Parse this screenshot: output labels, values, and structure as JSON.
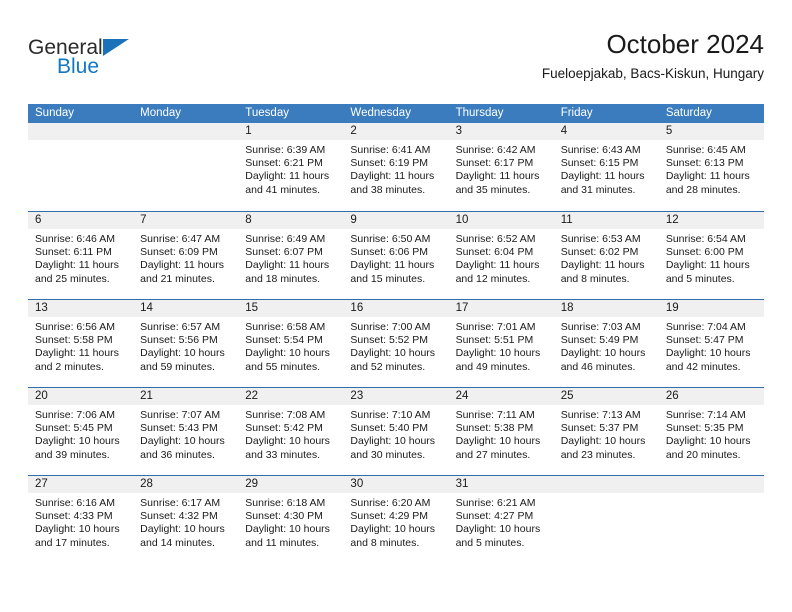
{
  "brand": {
    "name_part1": "General",
    "name_part2": "Blue",
    "accent_color": "#1b72b8"
  },
  "header": {
    "title": "October 2024",
    "subtitle": "Fueloepjakab, Bacs-Kiskun, Hungary"
  },
  "theme": {
    "header_blue": "#3a7cbe",
    "row_divider_blue": "#2f6ea8",
    "daynum_band": "#f0f0f0",
    "text": "#1a1a1a"
  },
  "weekdays": [
    "Sunday",
    "Monday",
    "Tuesday",
    "Wednesday",
    "Thursday",
    "Friday",
    "Saturday"
  ],
  "weeks": [
    [
      {
        "day": "",
        "sunrise": "",
        "sunset": "",
        "daylight_line1": "",
        "daylight_line2": ""
      },
      {
        "day": "",
        "sunrise": "",
        "sunset": "",
        "daylight_line1": "",
        "daylight_line2": ""
      },
      {
        "day": "1",
        "sunrise": "Sunrise: 6:39 AM",
        "sunset": "Sunset: 6:21 PM",
        "daylight_line1": "Daylight: 11 hours",
        "daylight_line2": "and 41 minutes."
      },
      {
        "day": "2",
        "sunrise": "Sunrise: 6:41 AM",
        "sunset": "Sunset: 6:19 PM",
        "daylight_line1": "Daylight: 11 hours",
        "daylight_line2": "and 38 minutes."
      },
      {
        "day": "3",
        "sunrise": "Sunrise: 6:42 AM",
        "sunset": "Sunset: 6:17 PM",
        "daylight_line1": "Daylight: 11 hours",
        "daylight_line2": "and 35 minutes."
      },
      {
        "day": "4",
        "sunrise": "Sunrise: 6:43 AM",
        "sunset": "Sunset: 6:15 PM",
        "daylight_line1": "Daylight: 11 hours",
        "daylight_line2": "and 31 minutes."
      },
      {
        "day": "5",
        "sunrise": "Sunrise: 6:45 AM",
        "sunset": "Sunset: 6:13 PM",
        "daylight_line1": "Daylight: 11 hours",
        "daylight_line2": "and 28 minutes."
      }
    ],
    [
      {
        "day": "6",
        "sunrise": "Sunrise: 6:46 AM",
        "sunset": "Sunset: 6:11 PM",
        "daylight_line1": "Daylight: 11 hours",
        "daylight_line2": "and 25 minutes."
      },
      {
        "day": "7",
        "sunrise": "Sunrise: 6:47 AM",
        "sunset": "Sunset: 6:09 PM",
        "daylight_line1": "Daylight: 11 hours",
        "daylight_line2": "and 21 minutes."
      },
      {
        "day": "8",
        "sunrise": "Sunrise: 6:49 AM",
        "sunset": "Sunset: 6:07 PM",
        "daylight_line1": "Daylight: 11 hours",
        "daylight_line2": "and 18 minutes."
      },
      {
        "day": "9",
        "sunrise": "Sunrise: 6:50 AM",
        "sunset": "Sunset: 6:06 PM",
        "daylight_line1": "Daylight: 11 hours",
        "daylight_line2": "and 15 minutes."
      },
      {
        "day": "10",
        "sunrise": "Sunrise: 6:52 AM",
        "sunset": "Sunset: 6:04 PM",
        "daylight_line1": "Daylight: 11 hours",
        "daylight_line2": "and 12 minutes."
      },
      {
        "day": "11",
        "sunrise": "Sunrise: 6:53 AM",
        "sunset": "Sunset: 6:02 PM",
        "daylight_line1": "Daylight: 11 hours",
        "daylight_line2": "and 8 minutes."
      },
      {
        "day": "12",
        "sunrise": "Sunrise: 6:54 AM",
        "sunset": "Sunset: 6:00 PM",
        "daylight_line1": "Daylight: 11 hours",
        "daylight_line2": "and 5 minutes."
      }
    ],
    [
      {
        "day": "13",
        "sunrise": "Sunrise: 6:56 AM",
        "sunset": "Sunset: 5:58 PM",
        "daylight_line1": "Daylight: 11 hours",
        "daylight_line2": "and 2 minutes."
      },
      {
        "day": "14",
        "sunrise": "Sunrise: 6:57 AM",
        "sunset": "Sunset: 5:56 PM",
        "daylight_line1": "Daylight: 10 hours",
        "daylight_line2": "and 59 minutes."
      },
      {
        "day": "15",
        "sunrise": "Sunrise: 6:58 AM",
        "sunset": "Sunset: 5:54 PM",
        "daylight_line1": "Daylight: 10 hours",
        "daylight_line2": "and 55 minutes."
      },
      {
        "day": "16",
        "sunrise": "Sunrise: 7:00 AM",
        "sunset": "Sunset: 5:52 PM",
        "daylight_line1": "Daylight: 10 hours",
        "daylight_line2": "and 52 minutes."
      },
      {
        "day": "17",
        "sunrise": "Sunrise: 7:01 AM",
        "sunset": "Sunset: 5:51 PM",
        "daylight_line1": "Daylight: 10 hours",
        "daylight_line2": "and 49 minutes."
      },
      {
        "day": "18",
        "sunrise": "Sunrise: 7:03 AM",
        "sunset": "Sunset: 5:49 PM",
        "daylight_line1": "Daylight: 10 hours",
        "daylight_line2": "and 46 minutes."
      },
      {
        "day": "19",
        "sunrise": "Sunrise: 7:04 AM",
        "sunset": "Sunset: 5:47 PM",
        "daylight_line1": "Daylight: 10 hours",
        "daylight_line2": "and 42 minutes."
      }
    ],
    [
      {
        "day": "20",
        "sunrise": "Sunrise: 7:06 AM",
        "sunset": "Sunset: 5:45 PM",
        "daylight_line1": "Daylight: 10 hours",
        "daylight_line2": "and 39 minutes."
      },
      {
        "day": "21",
        "sunrise": "Sunrise: 7:07 AM",
        "sunset": "Sunset: 5:43 PM",
        "daylight_line1": "Daylight: 10 hours",
        "daylight_line2": "and 36 minutes."
      },
      {
        "day": "22",
        "sunrise": "Sunrise: 7:08 AM",
        "sunset": "Sunset: 5:42 PM",
        "daylight_line1": "Daylight: 10 hours",
        "daylight_line2": "and 33 minutes."
      },
      {
        "day": "23",
        "sunrise": "Sunrise: 7:10 AM",
        "sunset": "Sunset: 5:40 PM",
        "daylight_line1": "Daylight: 10 hours",
        "daylight_line2": "and 30 minutes."
      },
      {
        "day": "24",
        "sunrise": "Sunrise: 7:11 AM",
        "sunset": "Sunset: 5:38 PM",
        "daylight_line1": "Daylight: 10 hours",
        "daylight_line2": "and 27 minutes."
      },
      {
        "day": "25",
        "sunrise": "Sunrise: 7:13 AM",
        "sunset": "Sunset: 5:37 PM",
        "daylight_line1": "Daylight: 10 hours",
        "daylight_line2": "and 23 minutes."
      },
      {
        "day": "26",
        "sunrise": "Sunrise: 7:14 AM",
        "sunset": "Sunset: 5:35 PM",
        "daylight_line1": "Daylight: 10 hours",
        "daylight_line2": "and 20 minutes."
      }
    ],
    [
      {
        "day": "27",
        "sunrise": "Sunrise: 6:16 AM",
        "sunset": "Sunset: 4:33 PM",
        "daylight_line1": "Daylight: 10 hours",
        "daylight_line2": "and 17 minutes."
      },
      {
        "day": "28",
        "sunrise": "Sunrise: 6:17 AM",
        "sunset": "Sunset: 4:32 PM",
        "daylight_line1": "Daylight: 10 hours",
        "daylight_line2": "and 14 minutes."
      },
      {
        "day": "29",
        "sunrise": "Sunrise: 6:18 AM",
        "sunset": "Sunset: 4:30 PM",
        "daylight_line1": "Daylight: 10 hours",
        "daylight_line2": "and 11 minutes."
      },
      {
        "day": "30",
        "sunrise": "Sunrise: 6:20 AM",
        "sunset": "Sunset: 4:29 PM",
        "daylight_line1": "Daylight: 10 hours",
        "daylight_line2": "and 8 minutes."
      },
      {
        "day": "31",
        "sunrise": "Sunrise: 6:21 AM",
        "sunset": "Sunset: 4:27 PM",
        "daylight_line1": "Daylight: 10 hours",
        "daylight_line2": "and 5 minutes."
      },
      {
        "day": "",
        "sunrise": "",
        "sunset": "",
        "daylight_line1": "",
        "daylight_line2": ""
      },
      {
        "day": "",
        "sunrise": "",
        "sunset": "",
        "daylight_line1": "",
        "daylight_line2": ""
      }
    ]
  ]
}
